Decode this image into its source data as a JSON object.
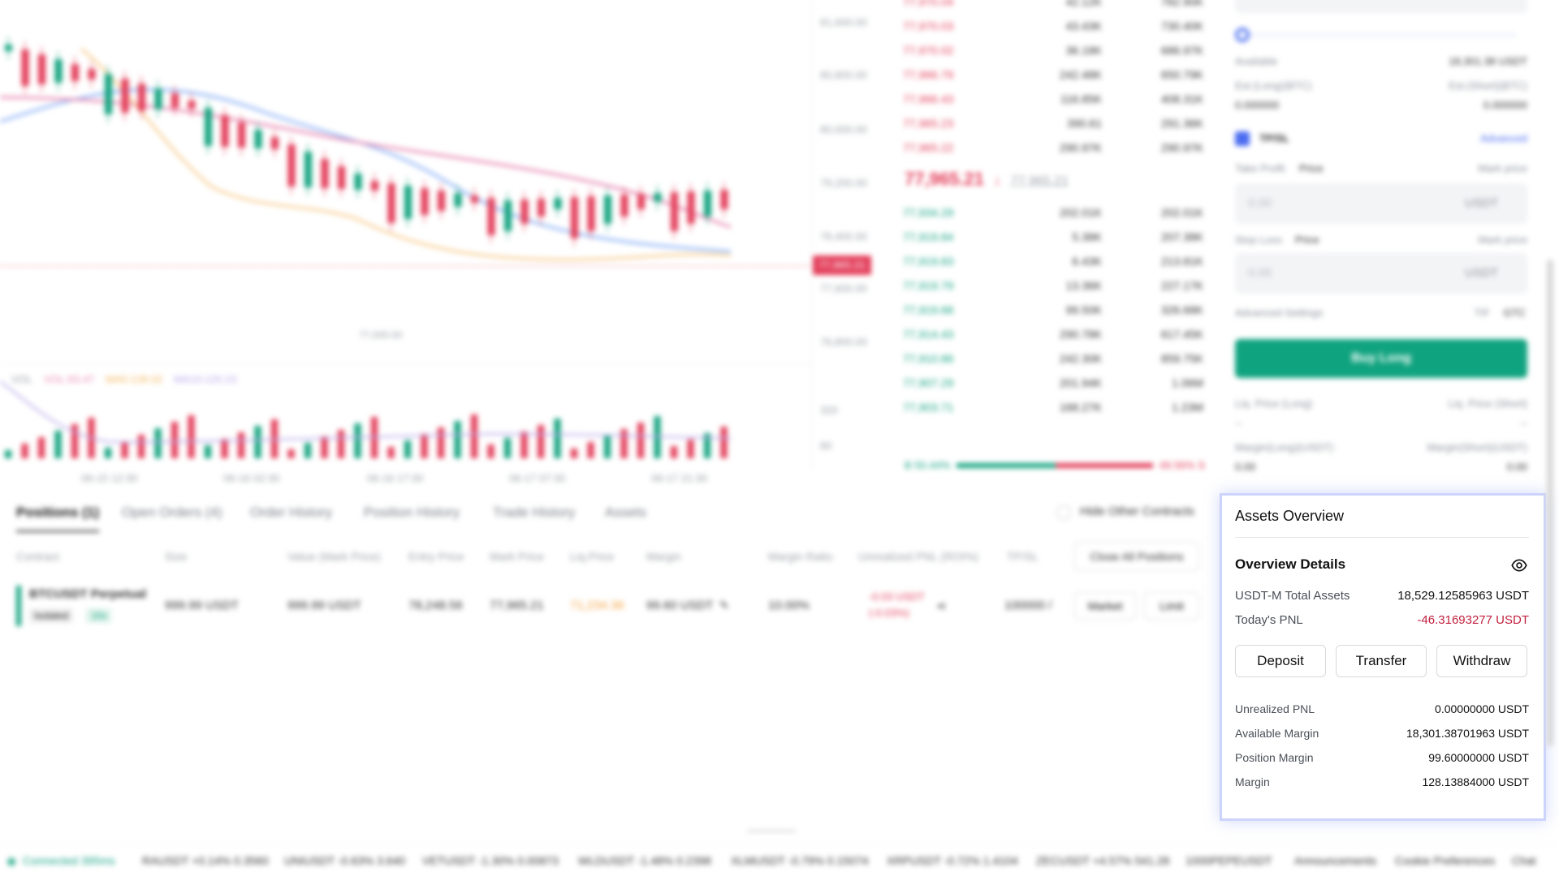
{
  "chart": {
    "price_labels": [
      "81,600.00",
      "80,800.00",
      "80,000.00",
      "79,200.00",
      "78,400.00",
      "77,600.00",
      "76,800.00"
    ],
    "current_price_tag": "77,965.21",
    "low_marker": "77,000.00",
    "vol_label": "VOL",
    "vol_value": "VOL:93.47",
    "ma5_value": "MA5:128.02",
    "ma10_value": "MA10:120.23",
    "vol_axis": [
      "320",
      "80"
    ],
    "time_labels": [
      "06-15 12:30",
      "06-16 02:30",
      "06-16 17:30",
      "06-17 07:30",
      "06-17 21:30"
    ],
    "colors": {
      "up": "#14a37f",
      "down": "#e33e5a",
      "ma_blue": "#8fb4f5",
      "ma_pink": "#e98bb3",
      "ma_orange": "#f4b860"
    }
  },
  "orderbook": {
    "asks": [
      [
        "77,970.04",
        "42.12K",
        "782.90K"
      ],
      [
        "77,970.03",
        "43.43K",
        "730.40K"
      ],
      [
        "77,970.02",
        "36.18K",
        "686.97K"
      ],
      [
        "77,966.79",
        "242.48K",
        "650.79K"
      ],
      [
        "77,966.43",
        "116.85K",
        "408.31K"
      ],
      [
        "77,965.23",
        "390.61",
        "291.36K"
      ],
      [
        "77,965.22",
        "290.97K",
        "290.97K"
      ]
    ],
    "last_price": "77,965.21",
    "mark_price": "77,965.21",
    "bids": [
      [
        "77,934.29",
        "202.01K",
        "202.01K"
      ],
      [
        "77,919.84",
        "5.38K",
        "207.38K"
      ],
      [
        "77,919.83",
        "6.43K",
        "213.81K"
      ],
      [
        "77,919.79",
        "13.36K",
        "227.17K"
      ],
      [
        "77,919.68",
        "99.50K",
        "326.68K"
      ],
      [
        "77,914.43",
        "290.78K",
        "617.45K"
      ],
      [
        "77,910.86",
        "242.30K",
        "859.75K"
      ],
      [
        "77,907.29",
        "201.94K",
        "1.06M"
      ],
      [
        "77,903.71",
        "168.27K",
        "1.23M"
      ]
    ],
    "buy_ratio": "B 50.44%",
    "sell_ratio": "49.56% S"
  },
  "order_form": {
    "available_label": "Available",
    "available_value": "18,301.38 USDT",
    "est_long": "Est.(Long)(BTC)",
    "est_short": "Est.(Short)(BTC)",
    "est_long_val": "0.000000",
    "est_short_val": "0.000000",
    "tpsl_label": "TP/SL",
    "advanced_label": "Advanced",
    "take_profit_label": "Take Profit",
    "price_label": "Price",
    "mark_price_label": "Mark price",
    "tp_placeholder": "0.00",
    "currency": "USDT",
    "stop_loss_label": "Stop Loss",
    "sl_placeholder": "0.00",
    "advanced_settings": "Advanced Settings",
    "tif_label": "TIF",
    "tif_value": "GTC",
    "buy_long": "Buy Long",
    "liq_long": "Liq. Price (Long)",
    "liq_short": "Liq. Price (Short)",
    "liq_long_val": "--",
    "liq_short_val": "--",
    "margin_long": "Margin(Long)(USDT)",
    "margin_short": "Margin(Short)(USDT)",
    "margin_long_val": "0.00",
    "margin_short_val": "0.00"
  },
  "bottom": {
    "tabs": [
      "Positions (1)",
      "Open Orders (4)",
      "Order History",
      "Position History",
      "Trade History",
      "Assets"
    ],
    "hide_other": "Hide Other Contracts",
    "columns": [
      "Contract",
      "Size",
      "Value (Mark Price)",
      "Entry Price",
      "Mark Price",
      "Liq.Price",
      "Margin",
      "Margin Ratio",
      "Unrealized PNL (ROI%)",
      "TP/SL"
    ],
    "close_all": "Close All Positions",
    "row": {
      "contract": "BTCUSDT Perpetual",
      "mode": "Isolated",
      "leverage": "10x",
      "size": "999.99 USDT",
      "value": "999.99 USDT",
      "entry": "78,248.56",
      "mark": "77,965.21",
      "liq": "71,234.36",
      "margin": "99.60 USDT",
      "margin_ratio": "10.00%",
      "pnl": "-0.03 USDT",
      "roi": "(-0.03%)",
      "tpsl": "100000 /",
      "market": "Market",
      "limit": "Limit"
    }
  },
  "assets": {
    "tab": "Assets Overview",
    "title": "Overview Details",
    "total_label": "USDT-M Total Assets",
    "total_value": "18,529.12585963 USDT",
    "pnl_label": "Today's PNL",
    "pnl_value": "-46.31693277 USDT",
    "deposit": "Deposit",
    "transfer": "Transfer",
    "withdraw": "Withdraw",
    "unrealized_label": "Unrealized PNL",
    "unrealized_value": "0.00000000 USDT",
    "available_label": "Available Margin",
    "available_value": "18,301.38701963 USDT",
    "position_label": "Position Margin",
    "position_value": "99.60000000 USDT",
    "margin_label": "Margin",
    "margin_value": "128.13884000 USDT"
  },
  "footer": {
    "connected": "Connected 395ms",
    "tickers": [
      "RAUSDT +0.14% 0.3560",
      "UNIUSDT -0.63% 3.640",
      "VETUSDT -1.30% 0.00873",
      "WLDUSDT -1.48% 0.2398",
      "XLMUSDT -0.79% 0.15074",
      "XRPUSDT -0.72% 1.4104",
      "ZECUSDT +4.57% 541.28",
      "1000PEPEUSDT"
    ],
    "announcements": "Announcements",
    "cookie": "Cookie Preferences",
    "chat": "Chat"
  }
}
